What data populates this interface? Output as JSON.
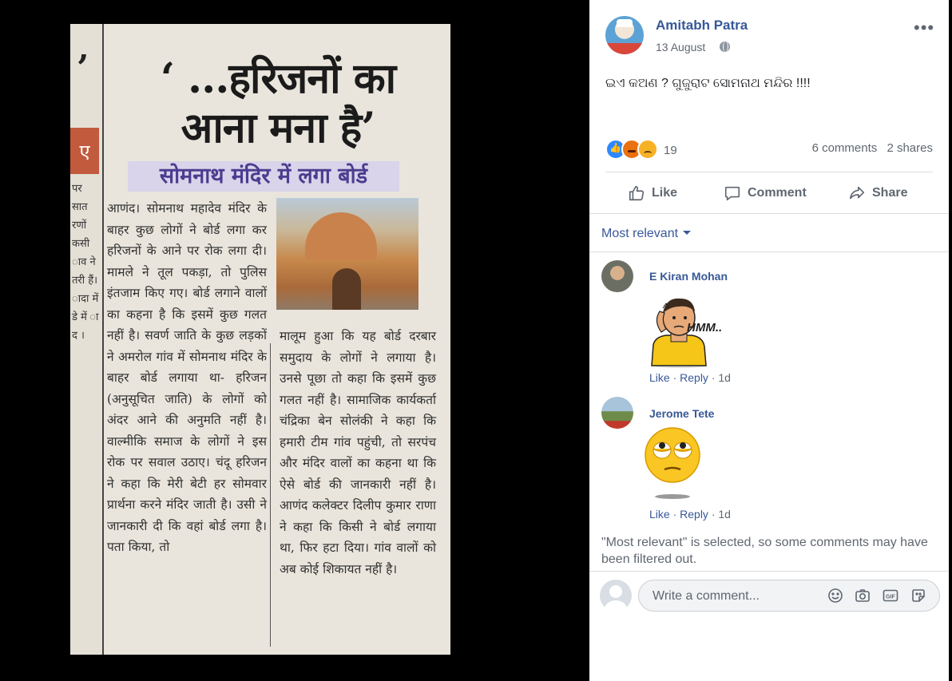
{
  "photo": {
    "headline_line1": "‘ ...हरिजनों का",
    "headline_line2": "आना मना है’",
    "subhead": "सोमनाथ मंदिर में लगा बोर्ड",
    "left_strip_mark": "’",
    "left_strip_box": "ए",
    "left_strip_text": "पर सात रणों कसी ाव ने तरी हैं। ादा में डे में ा द ।",
    "column1": "आणंद। सोमनाथ महादेव मंदिर के बाहर कुछ लोगों ने बोर्ड लगा कर हरिजनों के आने पर रोक लगा दी। मामले ने तूल पकड़ा, तो पुलिस इंतजाम किए गए। बोर्ड लगाने वालों का कहना है कि इसमें कुछ गलत नहीं है। सवर्ण जाति के कुछ लड़कों ने अमरोल गांव में सोमनाथ मंदिर के बाहर बोर्ड लगाया था- हरिजन (अनुसूचित जाति) के लोगों को अंदर आने की अनुमति नहीं है। वाल्मीकि समाज के लोगों ने इस रोक पर सवाल उठाए। चंदू हरिजन ने कहा कि मेरी बेटी हर सोमवार प्रार्थना करने मंदिर जाती है। उसी ने जानकारी दी कि वहां बोर्ड लगा है। पता किया, तो",
    "column2": "मालूम हुआ कि यह बोर्ड दरबार समुदाय के लोगों ने लगाया है। उनसे पूछा तो कहा कि इसमें कुछ गलत नहीं है। सामाजिक कार्यकर्ता चंद्रिका बेन सोलंकी ने कहा कि हमारी टीम गांव पहुंची, तो सरपंच और मंदिर वालों का कहना था कि ऐसे बोर्ड की जानकारी नहीं है। आणंद कलेक्टर दिलीप कुमार राणा ने कहा कि किसी ने बोर्ड लगाया था, फिर हटा दिया। गांव वालों को अब कोई शिकायत नहीं है।"
  },
  "post": {
    "author": "Amitabh Patra",
    "date": "13 August",
    "text": "ଇଏ କଅଣ ? ଗୁଜୁରାଟ ସୋମନାଥ ମନ୍ଦିର !!!!",
    "reaction_count": "19",
    "comments_count": "6 comments",
    "shares_count": "2 shares",
    "actions": {
      "like": "Like",
      "comment": "Comment",
      "share": "Share"
    }
  },
  "comments_section": {
    "sort_label": "Most relevant",
    "comments": [
      {
        "name": "E Kiran Mohan",
        "like": "Like",
        "reply": "Reply",
        "age": "1d",
        "sticker_text": "HMM.."
      },
      {
        "name": "Jerome Tete",
        "like": "Like",
        "reply": "Reply",
        "age": "1d"
      }
    ],
    "filter_note": "\"Most relevant\" is selected, so some comments may have been filtered out.",
    "composer_placeholder": "Write a comment..."
  },
  "colors": {
    "link_blue": "#385898",
    "author_blue": "#365899",
    "secondary_text": "#606770",
    "like_blue": "#2d88ff",
    "angry_orange": "#e9710f",
    "sad_yellow": "#f7b125"
  }
}
